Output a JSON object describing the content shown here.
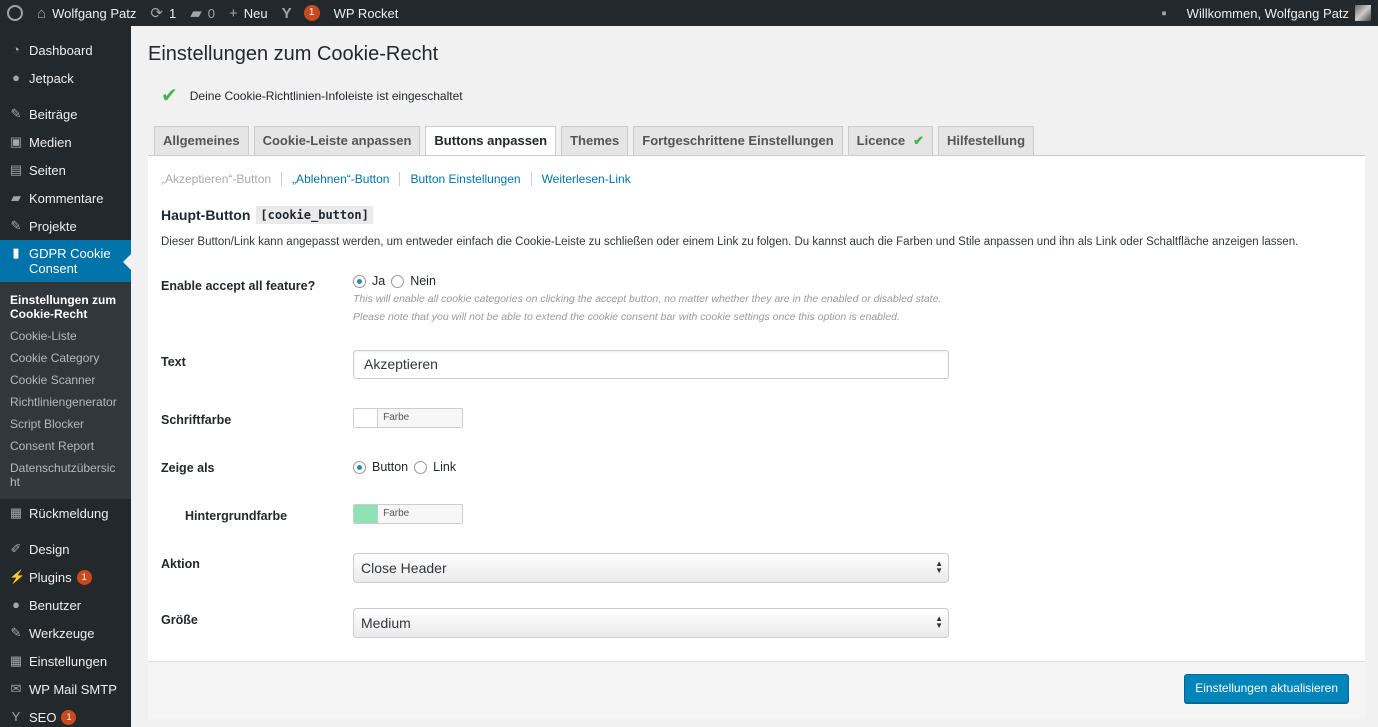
{
  "adminbar": {
    "site_name": "Wolfgang Patz",
    "updates_count": "1",
    "comments_count": "0",
    "new_label": "Neu",
    "yoast_badge": "1",
    "rocket_label": "WP Rocket",
    "greeting": "Willkommen, Wolfgang Patz"
  },
  "sidebar": {
    "items": [
      {
        "label": "Dashboard",
        "icon": "dashboard-icon"
      },
      {
        "label": "Jetpack",
        "icon": "jetpack-icon"
      },
      {
        "label": "Beiträge",
        "icon": "pin-icon"
      },
      {
        "label": "Medien",
        "icon": "media-icon"
      },
      {
        "label": "Seiten",
        "icon": "page-icon"
      },
      {
        "label": "Kommentare",
        "icon": "comment-icon"
      },
      {
        "label": "Projekte",
        "icon": "pin-icon"
      },
      {
        "label": "GDPR Cookie Consent",
        "icon": "lock-icon"
      }
    ],
    "submenu": [
      "Einstellungen zum Cookie-Recht",
      "Cookie-Liste",
      "Cookie Category",
      "Cookie Scanner",
      "Richtliniengenerator",
      "Script Blocker",
      "Consent Report",
      "Datenschutzübersicht"
    ],
    "items_after": [
      {
        "label": "Rückmeldung",
        "icon": "feedback-icon"
      },
      {
        "label": "Design",
        "icon": "brush-icon"
      },
      {
        "label": "Plugins",
        "icon": "plugin-icon",
        "badge": "1"
      },
      {
        "label": "Benutzer",
        "icon": "user-icon"
      },
      {
        "label": "Werkzeuge",
        "icon": "wrench-icon"
      },
      {
        "label": "Einstellungen",
        "icon": "settings-icon"
      },
      {
        "label": "WP Mail SMTP",
        "icon": "mail-icon"
      },
      {
        "label": "SEO",
        "icon": "yoast-icon",
        "badge": "1"
      }
    ]
  },
  "page": {
    "title": "Einstellungen zum Cookie-Recht",
    "notice": "Deine Cookie-Richtlinien-Infoleiste ist eingeschaltet"
  },
  "tabs": [
    "Allgemeines",
    "Cookie-Leiste anpassen",
    "Buttons anpassen",
    "Themes",
    "Fortgeschrittene Einstellungen",
    "Licence",
    "Hilfestellung"
  ],
  "subnav": [
    "„Akzeptieren“-Button",
    "„Ablehnen“-Button",
    "Button Einstellungen",
    "Weiterlesen-Link"
  ],
  "section": {
    "title": "Haupt-Button",
    "shortcode": "[cookie_button]",
    "description": "Dieser Button/Link kann angepasst werden, um entweder einfach die Cookie-Leiste zu schließen oder einem Link zu folgen. Du kannst auch die Farben und Stile anpassen und ihn als Link oder Schaltfläche anzeigen lassen."
  },
  "form": {
    "accept_all": {
      "label": "Enable accept all feature?",
      "opt_yes": "Ja",
      "opt_no": "Nein",
      "hint1": "This will enable all cookie categories on clicking the accept button, no matter whether they are in the enabled or disabled state.",
      "hint2": "Please note that you will not be able to extend the cookie consent bar with cookie settings once this option is enabled."
    },
    "text": {
      "label": "Text",
      "value": "Akzeptieren"
    },
    "font_color": {
      "label": "Schriftfarbe",
      "button": "Farbe auswählen",
      "swatch": "#ffffff"
    },
    "show_as": {
      "label": "Zeige als",
      "opt_button": "Button",
      "opt_link": "Link"
    },
    "bg_color": {
      "label": "Hintergrundfarbe",
      "button": "Farbe auswählen",
      "swatch": "#8ee3b6"
    },
    "action": {
      "label": "Aktion",
      "value": "Close Header"
    },
    "size": {
      "label": "Größe",
      "value": "Medium"
    }
  },
  "submit_label": "Einstellungen aktualisieren"
}
